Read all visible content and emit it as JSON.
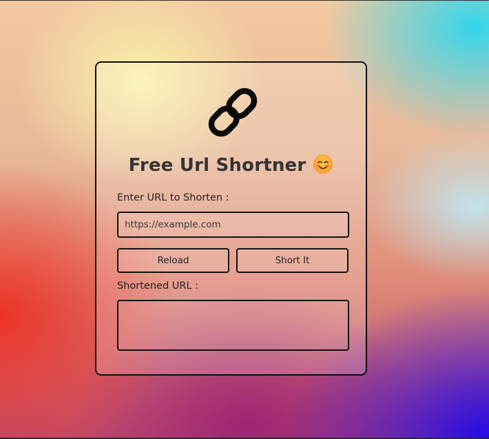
{
  "app": {
    "title": "Free Url Shortner",
    "title_icon": "smiling-face-emoji",
    "logo_icon": "link-icon"
  },
  "form": {
    "url_label": "Enter URL to Shorten :",
    "url_placeholder": "https://example.com",
    "url_value": "",
    "reload_label": "Reload",
    "short_label": "Short It",
    "result_label": "Shortened URL :",
    "result_value": ""
  },
  "colors": {
    "text": "#333333",
    "border": "#111111",
    "emoji_face": "#f7a23b"
  }
}
